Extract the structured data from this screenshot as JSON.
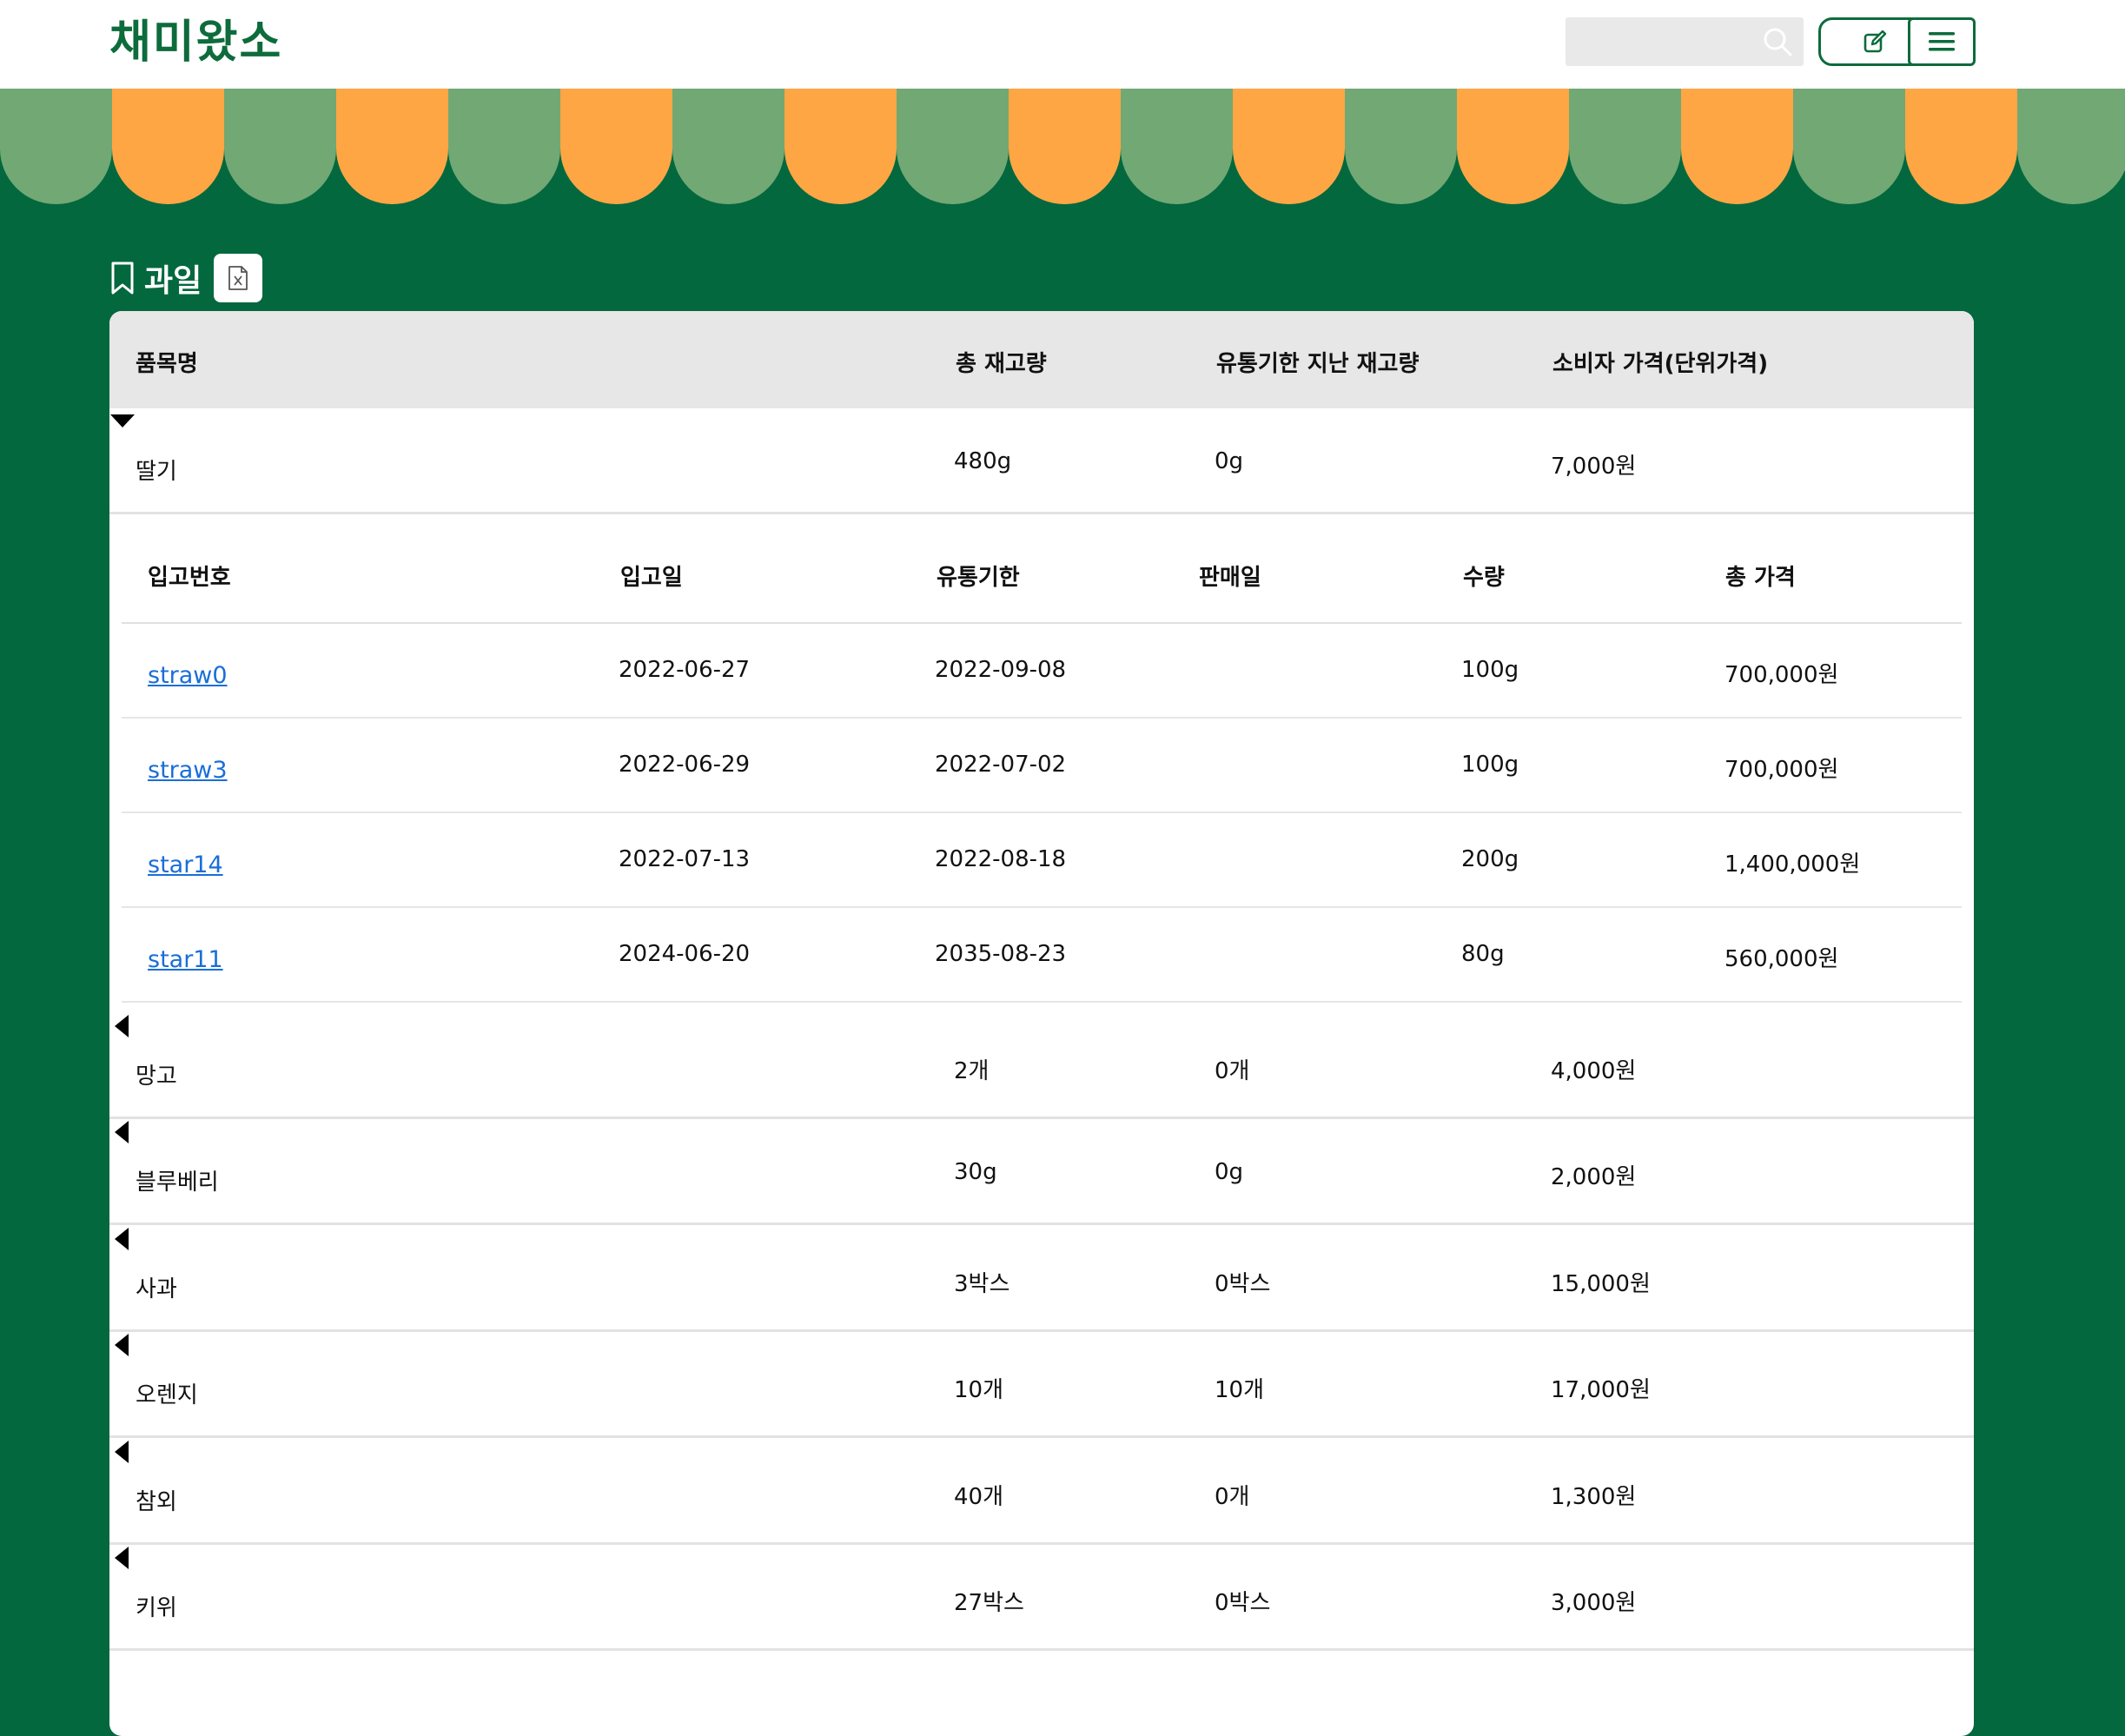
{
  "header": {
    "logo": "채미왔소",
    "search": {
      "placeholder": "",
      "icon": "search-icon"
    },
    "edit_icon": "edit-icon",
    "menu_icon": "hamburger-menu-icon"
  },
  "colors": {
    "brand_green": "#03683e",
    "awning_green": "#72a874",
    "awning_orange": "#ffa644",
    "link_blue": "#1a6ed8"
  },
  "section": {
    "title": "과일",
    "bookmark_icon": "bookmark-icon",
    "excel_icon": "excel-file-icon"
  },
  "table": {
    "headers": {
      "name": "품목명",
      "total": "총 재고량",
      "expired": "유통기한 지난 재고량",
      "price": "소비자 가격(단위가격)"
    },
    "rows": [
      {
        "name": "딸기",
        "total": "480g",
        "expired": "0g",
        "price": "7,000원",
        "expanded": true
      },
      {
        "name": "망고",
        "total": "2개",
        "expired": "0개",
        "price": "4,000원",
        "expanded": false
      },
      {
        "name": "블루베리",
        "total": "30g",
        "expired": "0g",
        "price": "2,000원",
        "expanded": false
      },
      {
        "name": "사과",
        "total": "3박스",
        "expired": "0박스",
        "price": "15,000원",
        "expanded": false
      },
      {
        "name": "오렌지",
        "total": "10개",
        "expired": "10개",
        "price": "17,000원",
        "expanded": false
      },
      {
        "name": "참외",
        "total": "40개",
        "expired": "0개",
        "price": "1,300원",
        "expanded": false
      },
      {
        "name": "키위",
        "total": "27박스",
        "expired": "0박스",
        "price": "3,000원",
        "expanded": false
      }
    ]
  },
  "detail": {
    "headers": {
      "id": "입고번호",
      "received": "입고일",
      "expiry": "유통기한",
      "sold": "판매일",
      "qty": "수량",
      "total_price": "총 가격"
    },
    "rows": [
      {
        "id": "straw0",
        "received": "2022-06-27",
        "expiry": "2022-09-08",
        "sold": "",
        "qty": "100g",
        "total_price": "700,000원"
      },
      {
        "id": "straw3",
        "received": "2022-06-29",
        "expiry": "2022-07-02",
        "sold": "",
        "qty": "100g",
        "total_price": "700,000원"
      },
      {
        "id": "star14",
        "received": "2022-07-13",
        "expiry": "2022-08-18",
        "sold": "",
        "qty": "200g",
        "total_price": "1,400,000원"
      },
      {
        "id": "star11",
        "received": "2024-06-20",
        "expiry": "2035-08-23",
        "sold": "",
        "qty": "80g",
        "total_price": "560,000원"
      }
    ]
  }
}
